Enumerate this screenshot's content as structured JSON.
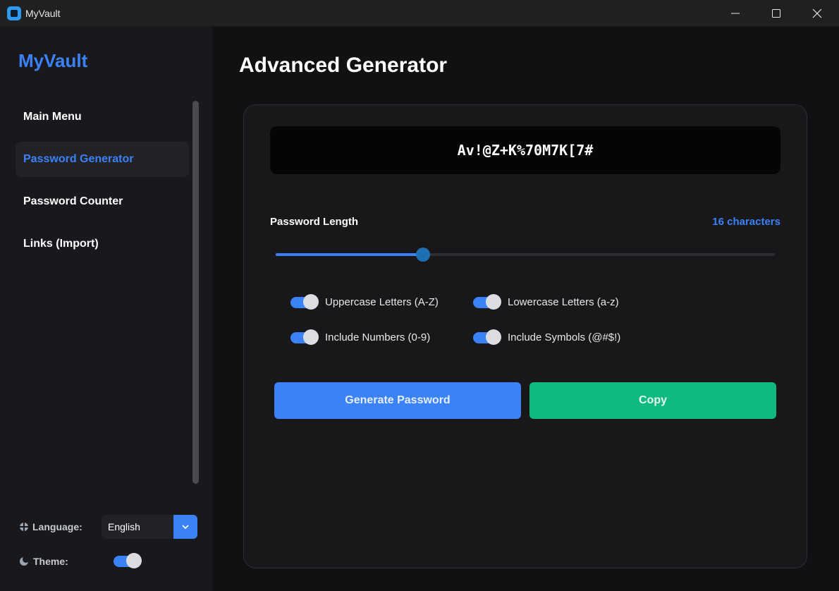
{
  "window": {
    "title": "MyVault"
  },
  "sidebar": {
    "brand": "MyVault",
    "items": [
      {
        "label": "Main Menu",
        "active": false
      },
      {
        "label": "Password Generator",
        "active": true
      },
      {
        "label": "Password Counter",
        "active": false
      },
      {
        "label": "Links (Import)",
        "active": false
      }
    ],
    "language_label": "Language:",
    "language_value": "English",
    "theme_label": "Theme:",
    "theme_on": true
  },
  "main": {
    "title": "Advanced Generator",
    "password": "Av!@Z+K%70M7K[7#",
    "length_label": "Password Length",
    "length_value": "16 characters",
    "slider_fraction": 0.295,
    "options": {
      "uppercase": {
        "label": "Uppercase Letters (A-Z)",
        "on": true
      },
      "lowercase": {
        "label": "Lowercase Letters (a-z)",
        "on": true
      },
      "numbers": {
        "label": "Include Numbers (0-9)",
        "on": true
      },
      "symbols": {
        "label": "Include Symbols (@#$!)",
        "on": true
      }
    },
    "generate_label": "Generate Password",
    "copy_label": "Copy"
  },
  "colors": {
    "accent": "#3b82f6",
    "success": "#10b981",
    "background": "#111113",
    "sidebar": "#19191d"
  }
}
